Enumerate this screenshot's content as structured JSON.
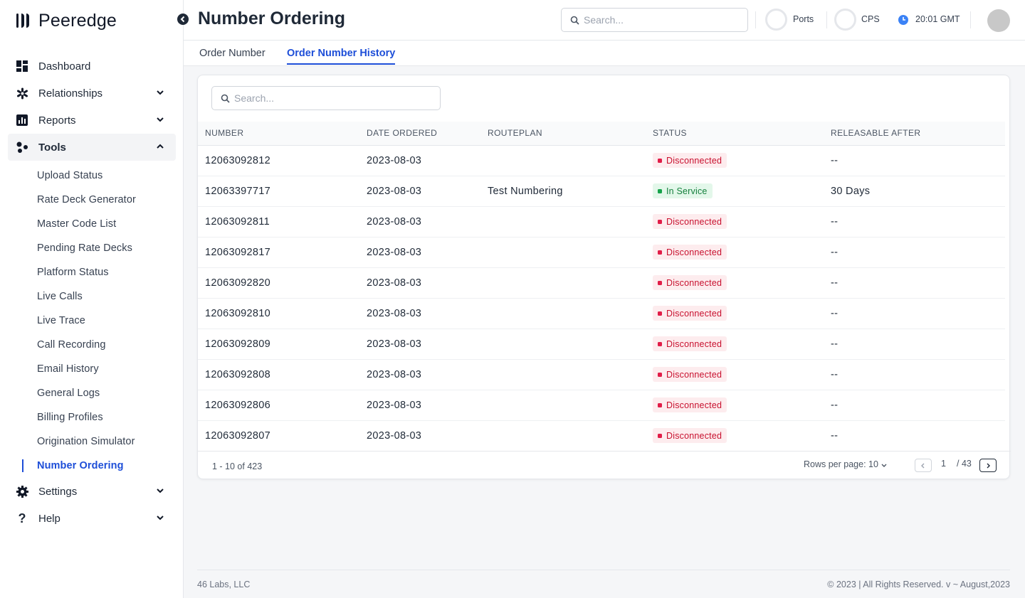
{
  "brand": {
    "name": "Peeredge"
  },
  "sidebar": {
    "items": [
      {
        "label": "Dashboard",
        "icon": "dashboard-icon"
      },
      {
        "label": "Relationships",
        "icon": "relationships-icon"
      },
      {
        "label": "Reports",
        "icon": "reports-icon"
      },
      {
        "label": "Tools",
        "icon": "tools-icon"
      }
    ],
    "tools_sub": [
      "Upload Status",
      "Rate Deck Generator",
      "Master Code List",
      "Pending Rate Decks",
      "Platform Status",
      "Live Calls",
      "Live Trace",
      "Call Recording",
      "Email History",
      "General Logs",
      "Billing Profiles",
      "Origination Simulator",
      "Number Ordering"
    ],
    "bottom": [
      {
        "label": "Settings",
        "icon": "gear-icon"
      },
      {
        "label": "Help",
        "icon": "help-icon"
      }
    ]
  },
  "header": {
    "title": "Number Ordering",
    "search_placeholder": "Search...",
    "ports_label": "Ports",
    "cps_label": "CPS",
    "time": "20:01 GMT"
  },
  "tabs": [
    "Order Number",
    "Order Number History"
  ],
  "table": {
    "search_placeholder": "Search...",
    "columns": [
      "NUMBER",
      "DATE ORDERED",
      "ROUTEPLAN",
      "STATUS",
      "RELEASABLE AFTER"
    ],
    "rows": [
      {
        "number": "12063092812",
        "date": "2023-08-03",
        "routeplan": "",
        "status": "Disconnected",
        "releasable": "--"
      },
      {
        "number": "12063397717",
        "date": "2023-08-03",
        "routeplan": "Test Numbering",
        "status": "In Service",
        "releasable": "30 Days"
      },
      {
        "number": "12063092811",
        "date": "2023-08-03",
        "routeplan": "",
        "status": "Disconnected",
        "releasable": "--"
      },
      {
        "number": "12063092817",
        "date": "2023-08-03",
        "routeplan": "",
        "status": "Disconnected",
        "releasable": "--"
      },
      {
        "number": "12063092820",
        "date": "2023-08-03",
        "routeplan": "",
        "status": "Disconnected",
        "releasable": "--"
      },
      {
        "number": "12063092810",
        "date": "2023-08-03",
        "routeplan": "",
        "status": "Disconnected",
        "releasable": "--"
      },
      {
        "number": "12063092809",
        "date": "2023-08-03",
        "routeplan": "",
        "status": "Disconnected",
        "releasable": "--"
      },
      {
        "number": "12063092808",
        "date": "2023-08-03",
        "routeplan": "",
        "status": "Disconnected",
        "releasable": "--"
      },
      {
        "number": "12063092806",
        "date": "2023-08-03",
        "routeplan": "",
        "status": "Disconnected",
        "releasable": "--"
      },
      {
        "number": "12063092807",
        "date": "2023-08-03",
        "routeplan": "",
        "status": "Disconnected",
        "releasable": "--"
      }
    ]
  },
  "pagination": {
    "range": "1 - 10 of 423",
    "rows_per_page": "Rows per page: 10",
    "current_page": "1",
    "total_pages": "/ 43"
  },
  "footer": {
    "left": "46 Labs, LLC",
    "right": "© 2023 | All Rights Reserved. v ~ August,2023"
  },
  "colors": {
    "accent": "#1d4ed8",
    "danger": "#c8102e",
    "success": "#15803d"
  }
}
